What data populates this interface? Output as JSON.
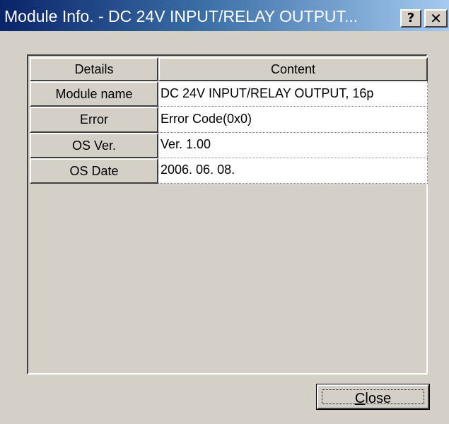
{
  "window": {
    "title": "Module Info. - DC 24V INPUT/RELAY OUTPUT...",
    "help_glyph": "?",
    "close_glyph": "✕"
  },
  "grid": {
    "headers": [
      "Details",
      "Content"
    ],
    "rows": [
      {
        "key": "Module name",
        "value": "DC 24V INPUT/RELAY OUTPUT, 16p"
      },
      {
        "key": "Error",
        "value": "Error Code(0x0)"
      },
      {
        "key": "OS Ver.",
        "value": "Ver. 1.00"
      },
      {
        "key": "OS Date",
        "value": "2006. 06. 08."
      }
    ]
  },
  "buttons": {
    "close_mnemonic": "C",
    "close_rest": "lose"
  }
}
